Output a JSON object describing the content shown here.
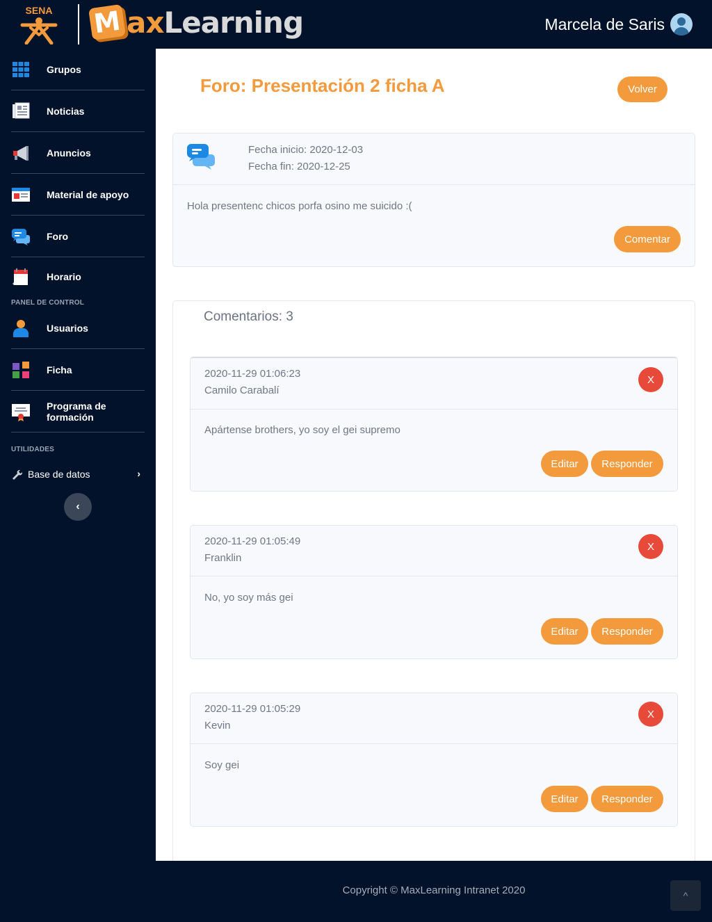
{
  "header": {
    "sena_text": "SENA",
    "brand_m": "M",
    "brand_ax": "ax",
    "brand_learning": "Learning",
    "user_name": "Marcela de Saris"
  },
  "sidebar": {
    "items": [
      {
        "label": "Grupos",
        "icon": "grid-icon"
      },
      {
        "label": "Noticias",
        "icon": "newspaper-icon"
      },
      {
        "label": "Anuncios",
        "icon": "megaphone-icon"
      },
      {
        "label": "Material de apoyo",
        "icon": "browser-window-icon"
      },
      {
        "label": "Foro",
        "icon": "chat-bubbles-icon"
      },
      {
        "label": "Horario",
        "icon": "calendar-icon"
      }
    ],
    "panel_title": "PANEL DE CONTROL",
    "panel_items": [
      {
        "label": "Usuarios",
        "icon": "user-icon"
      },
      {
        "label": "Ficha",
        "icon": "puzzle-icon"
      },
      {
        "label": "Programa de formación",
        "icon": "certificate-icon"
      }
    ],
    "utilities_title": "UTILIDADES",
    "database_label": "Base de datos",
    "chevron": "›",
    "collapse": "‹"
  },
  "forum": {
    "title": "Foro: Presentación 2 ficha A",
    "back_label": "Volver",
    "start_date": "Fecha inicio: 2020-12-03",
    "end_date": "Fecha fin: 2020-12-25",
    "body": "Hola presentenc chicos porfa osino me suicido :(",
    "comment_label": "Comentar"
  },
  "comments": {
    "heading": "Comentarios: 3",
    "edit_label": "Editar",
    "reply_label": "Responder",
    "delete_label": "X",
    "items": [
      {
        "timestamp": "2020-11-29 01:06:23",
        "author": "Camilo Carabalí",
        "text": "Apártense brothers, yo soy el gei supremo"
      },
      {
        "timestamp": "2020-11-29 01:05:49",
        "author": "Franklin",
        "text": "No, yo soy más gei"
      },
      {
        "timestamp": "2020-11-29 01:05:29",
        "author": "Kevin",
        "text": "Soy gei"
      }
    ]
  },
  "footer": {
    "copyright": "Copyright © MaxLearning Intranet 2020",
    "to_top": "^"
  },
  "colors": {
    "accent": "#f39a3d",
    "danger": "#e84a3a",
    "navy": "#03122b"
  }
}
